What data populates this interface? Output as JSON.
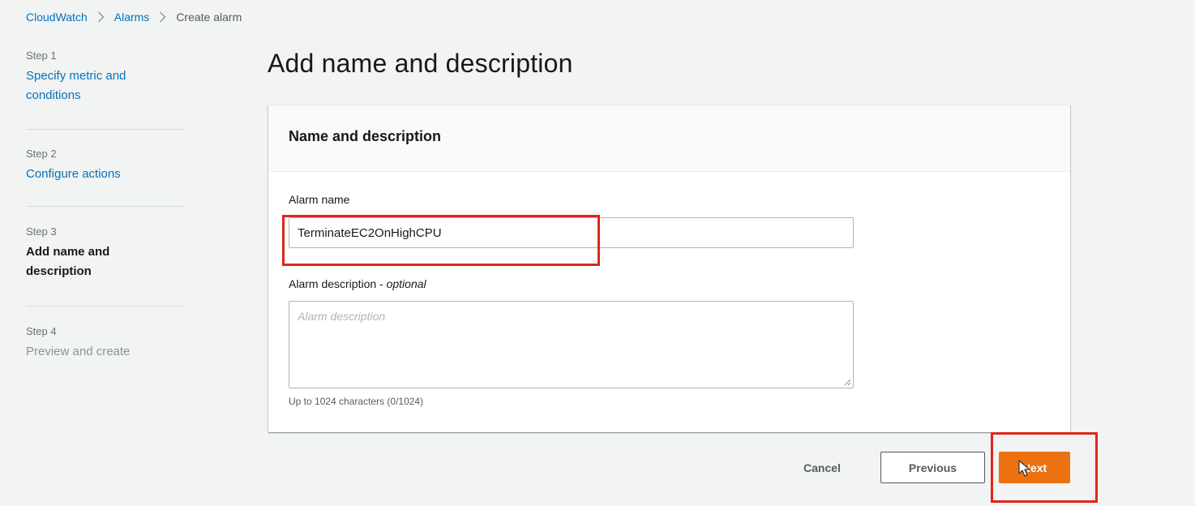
{
  "breadcrumb": {
    "items": [
      "CloudWatch",
      "Alarms"
    ],
    "current": "Create alarm"
  },
  "steps": [
    {
      "number": "Step 1",
      "title": "Specify metric and conditions",
      "state": "link"
    },
    {
      "number": "Step 2",
      "title": "Configure actions",
      "state": "link"
    },
    {
      "number": "Step 3",
      "title": "Add name and description",
      "state": "active"
    },
    {
      "number": "Step 4",
      "title": "Preview and create",
      "state": "disabled"
    }
  ],
  "page": {
    "title": "Add name and description"
  },
  "card": {
    "header": "Name and description",
    "alarm_name_label": "Alarm name",
    "alarm_name_value": "TerminateEC2OnHighCPU",
    "alarm_description_label": "Alarm description - ",
    "alarm_description_optional": "optional",
    "alarm_description_placeholder": "Alarm description",
    "alarm_description_hint": "Up to 1024 characters (0/1024)"
  },
  "actions": {
    "cancel_label": "Cancel",
    "previous_label": "Previous",
    "next_label": "Next"
  },
  "colors": {
    "link": "#0073bb",
    "primary_button": "#ec7211",
    "highlight": "#e0261a",
    "background": "#f2f3f3"
  },
  "icons": {
    "breadcrumb_separator": "chevron-right-icon",
    "cursor": "mouse-pointer-icon"
  }
}
